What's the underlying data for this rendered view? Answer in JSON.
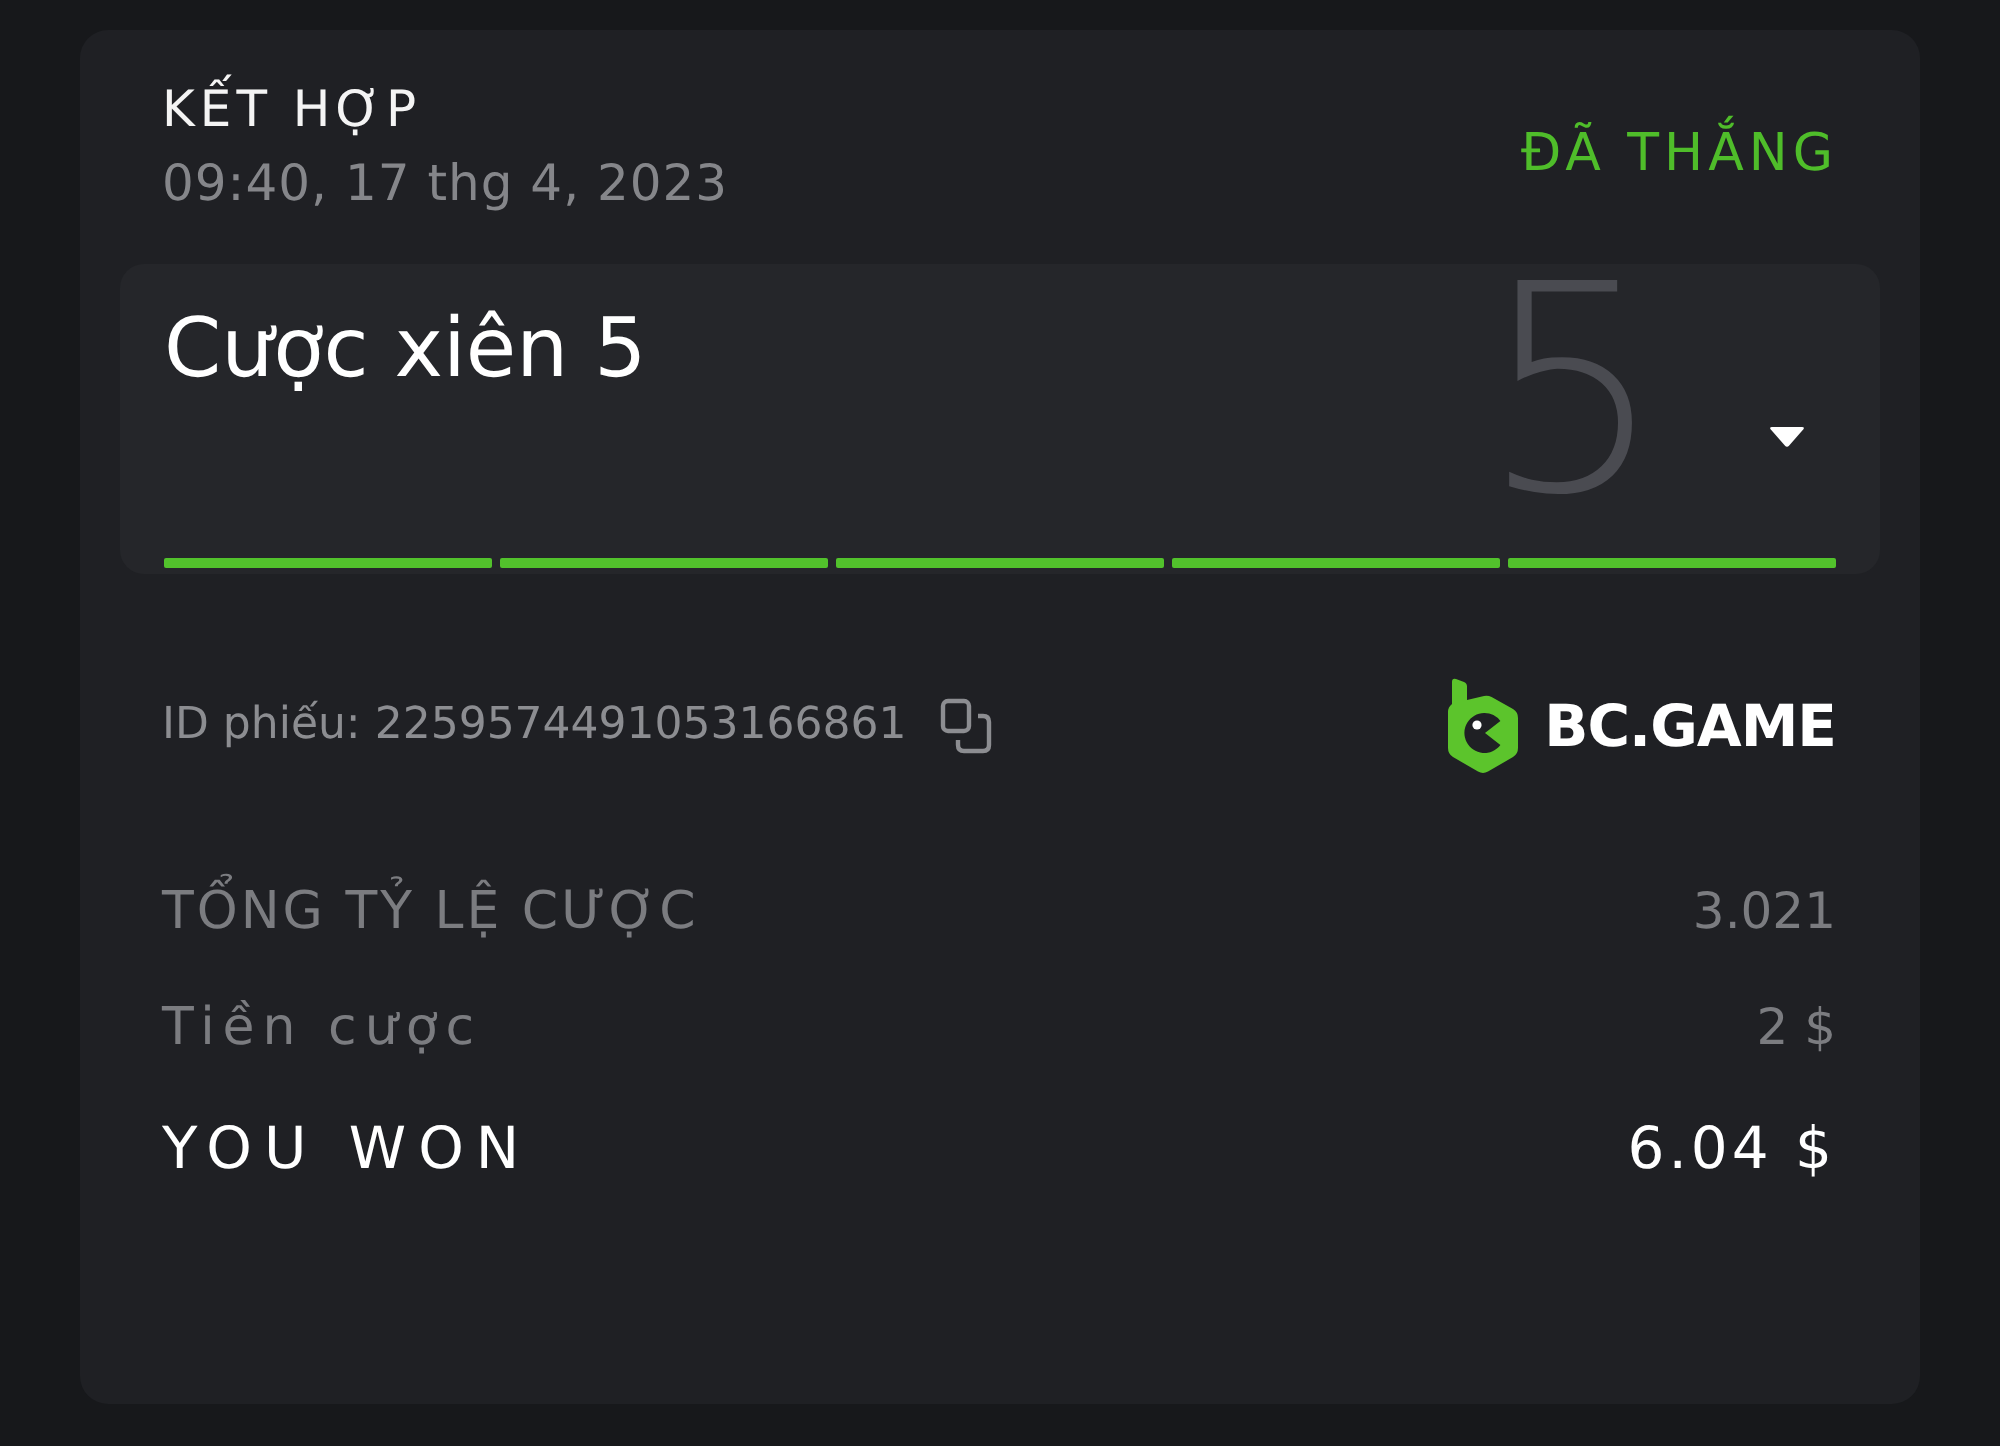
{
  "bet": {
    "type": "KẾT HỢP",
    "datetime": "09:40, 17 thg 4, 2023",
    "status": {
      "label": "ĐÃ THẮNG",
      "kind": "won"
    }
  },
  "parlay": {
    "title": "Cược xiên 5",
    "count": "5",
    "expanded": false,
    "legs": [
      {
        "won": true
      },
      {
        "won": true
      },
      {
        "won": true
      },
      {
        "won": true
      },
      {
        "won": true
      }
    ]
  },
  "ticket": {
    "id_text": "ID phiếu: 2259574491053166861"
  },
  "brand": {
    "name": "BC.GAME"
  },
  "summary": [
    {
      "label": "TỔNG TỶ LỆ CƯỢC",
      "value": "3.021",
      "emphasis": false
    },
    {
      "label": "Tiền cược",
      "value": "2 $",
      "emphasis": false
    },
    {
      "label": "YOU WON",
      "value": "6.04 $",
      "emphasis": true
    }
  ]
}
